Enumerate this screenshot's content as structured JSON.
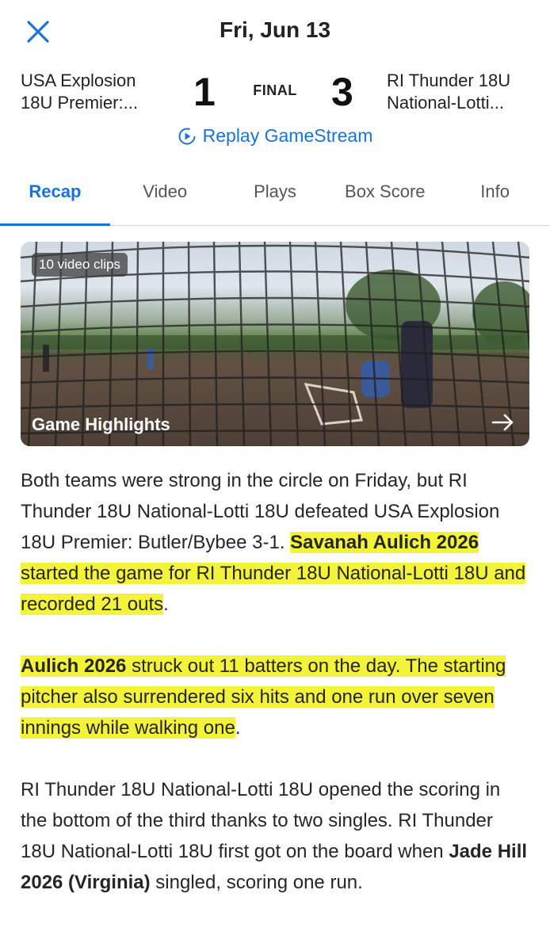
{
  "header": {
    "date": "Fri, Jun 13"
  },
  "game": {
    "away": {
      "line1": "USA Explosion",
      "line2": "18U Premier:...",
      "score": "1"
    },
    "home": {
      "line1": "RI Thunder 18U",
      "line2": "National-Lotti...",
      "score": "3"
    },
    "status": "FINAL",
    "replay_label": "Replay GameStream"
  },
  "tabs": [
    {
      "label": "Recap"
    },
    {
      "label": "Video"
    },
    {
      "label": "Plays"
    },
    {
      "label": "Box Score"
    },
    {
      "label": "Info"
    }
  ],
  "video": {
    "badge": "10 video clips",
    "title": "Game Highlights"
  },
  "article": {
    "p1": {
      "a": "Both teams were strong in the circle on Friday, but RI Thunder 18U National-Lotti 18U defeated USA Explosion 18U Premier: Butler/Bybee 3-1. ",
      "b": "Savanah Aulich 2026",
      "c": " started the game for RI Thunder 18U National-Lotti 18U and recorded 21 outs",
      "d": "."
    },
    "p2": {
      "a": "Aulich 2026",
      "b": " struck out 11 batters on the day. The starting pitcher also surrendered six hits and one run over seven innings while walking one",
      "c": "."
    },
    "p3": {
      "a": "RI Thunder 18U National-Lotti 18U opened the scoring in the bottom of the third thanks to two singles. RI Thunder 18U National-Lotti 18U first got on the board when ",
      "b": "Jade Hill 2026 (Virginia)",
      "c": " singled, scoring one run."
    }
  },
  "colors": {
    "accent": "#1a73d9",
    "highlight": "#f3f33a"
  }
}
